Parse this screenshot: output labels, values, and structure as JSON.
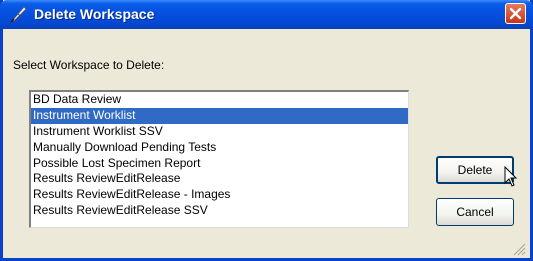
{
  "window": {
    "title": "Delete Workspace"
  },
  "dialog": {
    "prompt": "Select Workspace to Delete:",
    "workspaces": [
      {
        "label": "BD Data Review",
        "selected": false
      },
      {
        "label": "Instrument Worklist",
        "selected": true
      },
      {
        "label": "Instrument Worklist SSV",
        "selected": false
      },
      {
        "label": "Manually Download Pending Tests",
        "selected": false
      },
      {
        "label": "Possible Lost Specimen Report",
        "selected": false
      },
      {
        "label": "Results ReviewEditRelease",
        "selected": false
      },
      {
        "label": "Results ReviewEditRelease - Images",
        "selected": false
      },
      {
        "label": "Results ReviewEditRelease SSV",
        "selected": false
      }
    ],
    "delete_label": "Delete",
    "cancel_label": "Cancel"
  },
  "colors": {
    "titlebar": "#0551e0",
    "selection": "#316ac5",
    "close_button": "#c4361a",
    "dialog_background": "#ece9d8"
  },
  "icons": [
    "quill-icon",
    "close-icon",
    "mouse-cursor-icon",
    "resize-grip-icon"
  ]
}
